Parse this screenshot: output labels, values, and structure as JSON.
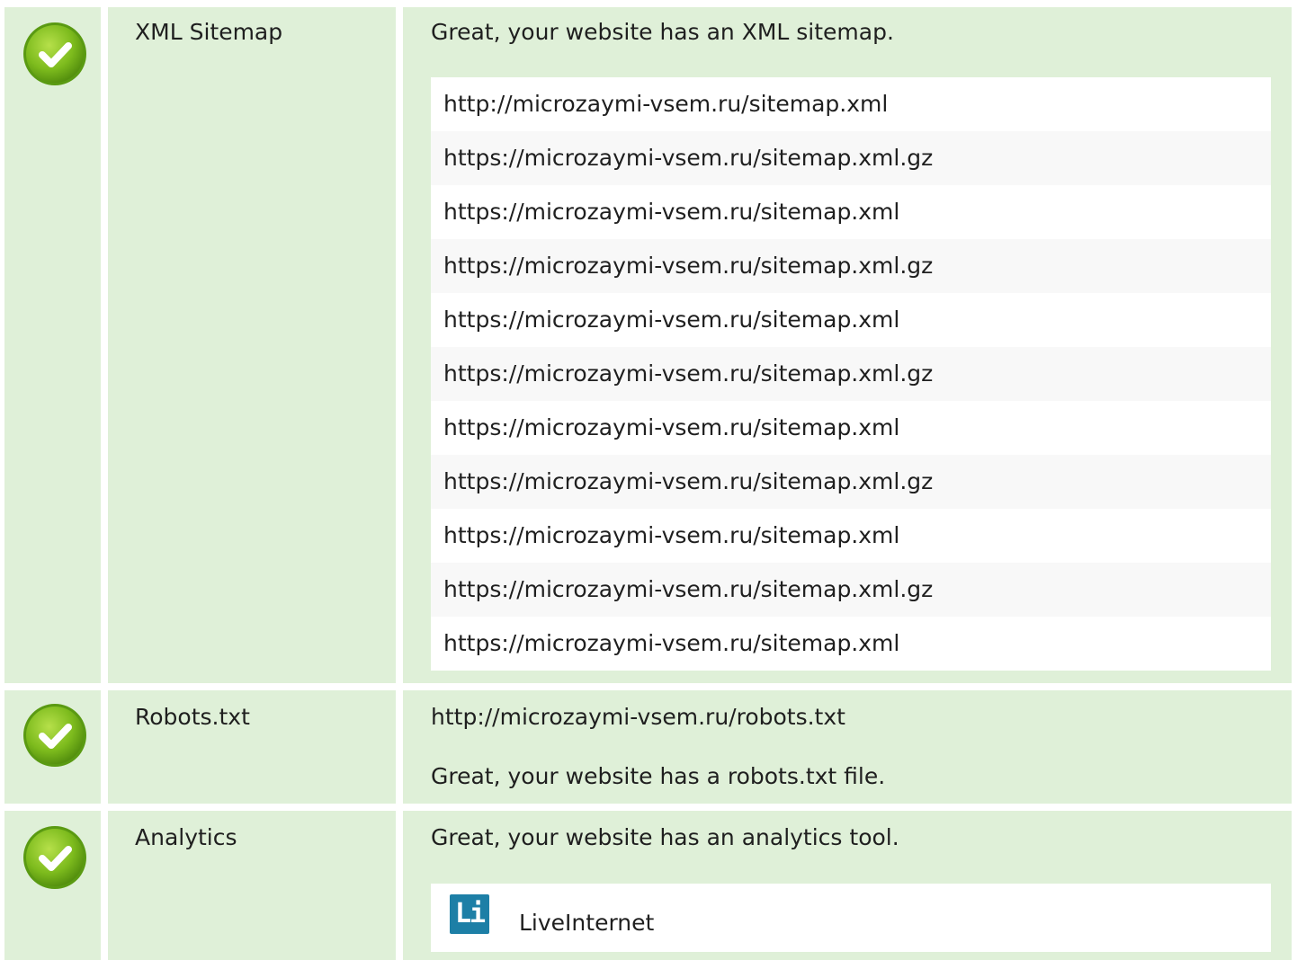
{
  "rows": [
    {
      "name": "XML Sitemap",
      "status_icon": "check-circle-icon",
      "intro": "Great, your website has an XML sitemap.",
      "sitemaps": [
        "http://microzaymi-vsem.ru/sitemap.xml",
        "https://microzaymi-vsem.ru/sitemap.xml.gz",
        "https://microzaymi-vsem.ru/sitemap.xml",
        "https://microzaymi-vsem.ru/sitemap.xml.gz",
        "https://microzaymi-vsem.ru/sitemap.xml",
        "https://microzaymi-vsem.ru/sitemap.xml.gz",
        "https://microzaymi-vsem.ru/sitemap.xml",
        "https://microzaymi-vsem.ru/sitemap.xml.gz",
        "https://microzaymi-vsem.ru/sitemap.xml",
        "https://microzaymi-vsem.ru/sitemap.xml.gz",
        "https://microzaymi-vsem.ru/sitemap.xml"
      ]
    },
    {
      "name": "Robots.txt",
      "status_icon": "check-circle-icon",
      "url": "http://microzaymi-vsem.ru/robots.txt",
      "message": "Great, your website has a robots.txt file."
    },
    {
      "name": "Analytics",
      "status_icon": "check-circle-icon",
      "intro": "Great, your website has an analytics tool.",
      "tools": [
        {
          "logo_text": "Li",
          "name": "LiveInternet",
          "icon": "liveinternet-logo-icon"
        }
      ]
    }
  ],
  "colors": {
    "row_bg": "#dff0d8",
    "check_green": "#7dbb1d",
    "logo_blue": "#1d7fa6"
  }
}
